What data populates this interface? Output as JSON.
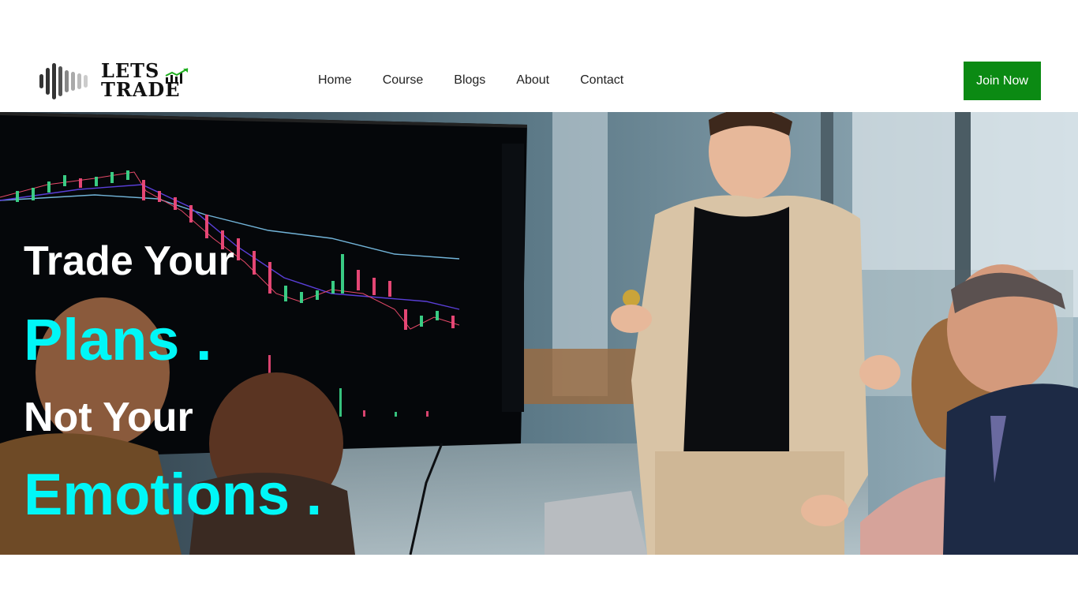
{
  "brand": {
    "line1": "LETS",
    "line2": "TRADE",
    "icon": "soundwave-logo-icon"
  },
  "nav": {
    "items": [
      {
        "label": "Home"
      },
      {
        "label": "Course"
      },
      {
        "label": "Blogs"
      },
      {
        "label": "About"
      },
      {
        "label": "Contact"
      }
    ]
  },
  "cta": {
    "label": "Join Now",
    "color": "#0b8a13"
  },
  "hero": {
    "line1": "Trade Your",
    "line2": "Plans .",
    "line3": "Not Your",
    "line4": "Emotions .",
    "accent_color": "#00f7f7",
    "image": "office-trading-presentation-photo"
  }
}
